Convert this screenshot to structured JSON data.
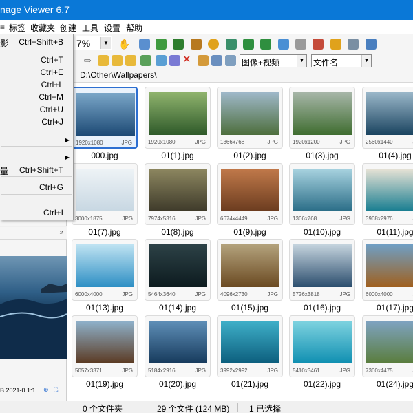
{
  "window": {
    "title": "nage Viewer 6.7"
  },
  "menu": [
    "标签",
    "收藏夹",
    "创建",
    "工具",
    "设置",
    "帮助"
  ],
  "toolbar": {
    "zoom": "7%",
    "filter": "图像+视频",
    "sort": "文件名"
  },
  "address": {
    "path": "D:\\Other\\Wallpapers\\"
  },
  "context_menu": [
    {
      "label": "影",
      "shortcut": "Ctrl+Shift+B",
      "submenu": false
    },
    {
      "label": "",
      "shortcut": "Ctrl+T",
      "submenu": false
    },
    {
      "label": "",
      "shortcut": "Ctrl+E",
      "submenu": false
    },
    {
      "label": "",
      "shortcut": "Ctrl+L",
      "submenu": false
    },
    {
      "label": "",
      "shortcut": "Ctrl+M",
      "submenu": false
    },
    {
      "label": "",
      "shortcut": "Ctrl+U",
      "submenu": false
    },
    {
      "label": "",
      "shortcut": "Ctrl+J",
      "submenu": false
    },
    {
      "label": "",
      "shortcut": "",
      "submenu": true
    },
    {
      "label": "",
      "shortcut": "",
      "submenu": true
    },
    {
      "label": "量",
      "shortcut": "Ctrl+Shift+T",
      "submenu": false
    },
    {
      "label": "",
      "shortcut": "Ctrl+G",
      "submenu": false
    },
    {
      "label": "",
      "shortcut": "Ctrl+I",
      "submenu": false
    }
  ],
  "preview": {
    "info": "B  2021-0  1:1"
  },
  "thumbnails": [
    {
      "dims": "1920x1080",
      "fmt": "JPG",
      "name": "000.jpg",
      "c1": "#1d4a75",
      "c2": "#7aa6c8",
      "selected": true
    },
    {
      "dims": "1920x1080",
      "fmt": "JPG",
      "name": "01(1).jpg",
      "c1": "#2f5a2a",
      "c2": "#8fb36d"
    },
    {
      "dims": "1366x768",
      "fmt": "JPG",
      "name": "01(2).jpg",
      "c1": "#4d6e3c",
      "c2": "#9fb8c9"
    },
    {
      "dims": "1920x1200",
      "fmt": "JPG",
      "name": "01(3).jpg",
      "c1": "#3f6d30",
      "c2": "#a7b6a8"
    },
    {
      "dims": "2560x1440",
      "fmt": "JPG",
      "name": "01(4).jpg",
      "c1": "#1b4460",
      "c2": "#9ab7c9"
    },
    {
      "dims": "3000x1875",
      "fmt": "JPG",
      "name": "01(7).jpg",
      "c1": "#c7d7e2",
      "c2": "#eef3f6"
    },
    {
      "dims": "7974x5316",
      "fmt": "JPG",
      "name": "01(8).jpg",
      "c1": "#3e3a2a",
      "c2": "#8d8760"
    },
    {
      "dims": "6674x4449",
      "fmt": "JPG",
      "name": "01(9).jpg",
      "c1": "#6b3c1f",
      "c2": "#c1794a"
    },
    {
      "dims": "1366x768",
      "fmt": "JPG",
      "name": "01(10).jpg",
      "c1": "#2a6d87",
      "c2": "#a8d3e0"
    },
    {
      "dims": "3968x2976",
      "fmt": "JPG",
      "name": "01(11).jpg",
      "c1": "#177d90",
      "c2": "#e8e3d6"
    },
    {
      "dims": "6000x4000",
      "fmt": "JPG",
      "name": "01(13).jpg",
      "c1": "#2e8fc4",
      "c2": "#bfe3f2"
    },
    {
      "dims": "5464x3640",
      "fmt": "JPG",
      "name": "01(14).jpg",
      "c1": "#0d1b1f",
      "c2": "#2c4146"
    },
    {
      "dims": "4096x2730",
      "fmt": "JPG",
      "name": "01(15).jpg",
      "c1": "#6b4a22",
      "c2": "#b3a27c"
    },
    {
      "dims": "5726x3818",
      "fmt": "JPG",
      "name": "01(16).jpg",
      "c1": "#2c4e6e",
      "c2": "#c5d4de"
    },
    {
      "dims": "6000x4000",
      "fmt": "JPG",
      "name": "01(17).jpg",
      "c1": "#a0601e",
      "c2": "#6f9fc4"
    },
    {
      "dims": "5057x3371",
      "fmt": "JPG",
      "name": "01(19).jpg",
      "c1": "#5b3a22",
      "c2": "#8fb2cc"
    },
    {
      "dims": "5184x2916",
      "fmt": "JPG",
      "name": "01(20).jpg",
      "c1": "#163a5c",
      "c2": "#5f8fb8"
    },
    {
      "dims": "3992x2992",
      "fmt": "JPG",
      "name": "01(21).jpg",
      "c1": "#0c5e7d",
      "c2": "#3fb0c9"
    },
    {
      "dims": "5410x3461",
      "fmt": "JPG",
      "name": "01(22).jpg",
      "c1": "#0f8fb1",
      "c2": "#7fd3e0"
    },
    {
      "dims": "7360x4475",
      "fmt": "JPG",
      "name": "01(24).jpg",
      "c1": "#5a7d3c",
      "c2": "#7fa3c2"
    }
  ],
  "status": {
    "folders": "0 个文件夹",
    "files": "29 个文件 (124 MB)",
    "selected": "1 已选择"
  },
  "colors": {
    "title_bar": "#0a78d7",
    "selection": "#2d6fd1"
  }
}
